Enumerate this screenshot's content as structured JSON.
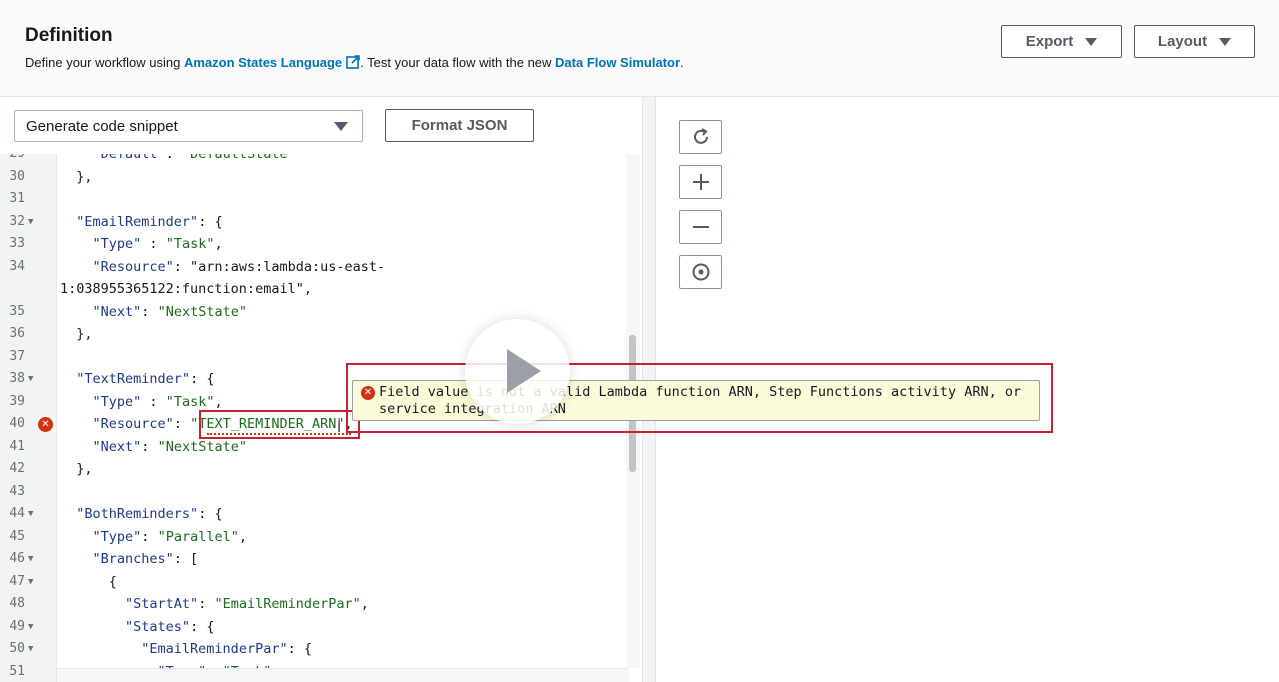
{
  "header": {
    "title": "Definition",
    "subtitle_prefix": "Define your workflow using ",
    "asl_link": "Amazon States Language",
    "subtitle_middle": ". Test your data flow with the new ",
    "simulator_link": "Data Flow Simulator",
    "subtitle_suffix": ".",
    "export_label": "Export",
    "layout_label": "Layout"
  },
  "toolbar": {
    "snippet_select": "Generate code snippet",
    "format_label": "Format JSON"
  },
  "editor": {
    "lines": [
      {
        "n": "29",
        "fold": false,
        "text": "    \"Default\": \"DefaultState\""
      },
      {
        "n": "30",
        "fold": false,
        "text": "  },"
      },
      {
        "n": "31",
        "fold": false,
        "text": ""
      },
      {
        "n": "32",
        "fold": true,
        "text": "  \"EmailReminder\": {"
      },
      {
        "n": "33",
        "fold": false,
        "text": "    \"Type\" : \"Task\","
      },
      {
        "n": "34",
        "fold": false,
        "text": "    \"Resource\": \"arn:aws:lambda:us-east-"
      },
      {
        "n": "",
        "fold": false,
        "text": "1:038955365122:function:email\","
      },
      {
        "n": "35",
        "fold": false,
        "text": "    \"Next\": \"NextState\""
      },
      {
        "n": "36",
        "fold": false,
        "text": "  },"
      },
      {
        "n": "37",
        "fold": false,
        "text": ""
      },
      {
        "n": "38",
        "fold": true,
        "text": "  \"TextReminder\": {"
      },
      {
        "n": "39",
        "fold": false,
        "text": "    \"Type\" : \"Task\","
      },
      {
        "n": "40",
        "fold": false,
        "text": "    \"Resource\": \"TEXT_REMINDER_ARN\","
      },
      {
        "n": "41",
        "fold": false,
        "text": "    \"Next\": \"NextState\""
      },
      {
        "n": "42",
        "fold": false,
        "text": "  },"
      },
      {
        "n": "43",
        "fold": false,
        "text": ""
      },
      {
        "n": "44",
        "fold": true,
        "text": "  \"BothReminders\": {"
      },
      {
        "n": "45",
        "fold": false,
        "text": "    \"Type\": \"Parallel\","
      },
      {
        "n": "46",
        "fold": true,
        "text": "    \"Branches\": ["
      },
      {
        "n": "47",
        "fold": true,
        "text": "      {"
      },
      {
        "n": "48",
        "fold": false,
        "text": "        \"StartAt\": \"EmailReminderPar\","
      },
      {
        "n": "49",
        "fold": true,
        "text": "        \"States\": {"
      },
      {
        "n": "50",
        "fold": true,
        "text": "          \"EmailReminderPar\": {"
      },
      {
        "n": "51",
        "fold": false,
        "text": "            \"Type\": \"Task\","
      }
    ],
    "error_line": "40",
    "error_message": "Field value is not a valid Lambda function ARN, Step Functions activity ARN, or service integration ARN"
  },
  "graph_controls": [
    "refresh-icon",
    "zoom-in-icon",
    "zoom-out-icon",
    "center-icon"
  ]
}
